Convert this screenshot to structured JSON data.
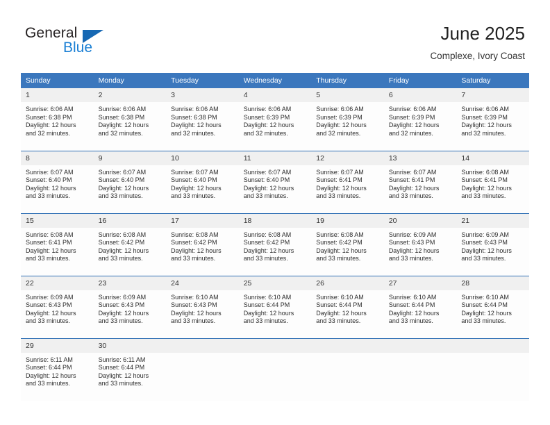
{
  "brand": {
    "name_part1": "General",
    "name_part2": "Blue",
    "triangle_icon": "triangle-logo-icon",
    "colors": {
      "dark": "#231f20",
      "blue": "#1a7fd4",
      "triangle": "#1668b3"
    }
  },
  "header": {
    "title": "June 2025",
    "subtitle": "Complexe, Ivory Coast"
  },
  "theme": {
    "header_blue": "#3b77bd",
    "row_divider_blue": "#2f6fb5",
    "daynum_band": "#f0f0f0",
    "cell_bg": "#fdfdfd",
    "text": "#2b2b2b"
  },
  "weekday_headers": [
    "Sunday",
    "Monday",
    "Tuesday",
    "Wednesday",
    "Thursday",
    "Friday",
    "Saturday"
  ],
  "weeks": [
    {
      "days": [
        {
          "num": "1",
          "sunrise": "Sunrise: 6:06 AM",
          "sunset": "Sunset: 6:38 PM",
          "daylight1": "Daylight: 12 hours",
          "daylight2": "and 32 minutes.",
          "blank": false
        },
        {
          "num": "2",
          "sunrise": "Sunrise: 6:06 AM",
          "sunset": "Sunset: 6:38 PM",
          "daylight1": "Daylight: 12 hours",
          "daylight2": "and 32 minutes.",
          "blank": false
        },
        {
          "num": "3",
          "sunrise": "Sunrise: 6:06 AM",
          "sunset": "Sunset: 6:38 PM",
          "daylight1": "Daylight: 12 hours",
          "daylight2": "and 32 minutes.",
          "blank": false
        },
        {
          "num": "4",
          "sunrise": "Sunrise: 6:06 AM",
          "sunset": "Sunset: 6:39 PM",
          "daylight1": "Daylight: 12 hours",
          "daylight2": "and 32 minutes.",
          "blank": false
        },
        {
          "num": "5",
          "sunrise": "Sunrise: 6:06 AM",
          "sunset": "Sunset: 6:39 PM",
          "daylight1": "Daylight: 12 hours",
          "daylight2": "and 32 minutes.",
          "blank": false
        },
        {
          "num": "6",
          "sunrise": "Sunrise: 6:06 AM",
          "sunset": "Sunset: 6:39 PM",
          "daylight1": "Daylight: 12 hours",
          "daylight2": "and 32 minutes.",
          "blank": false
        },
        {
          "num": "7",
          "sunrise": "Sunrise: 6:06 AM",
          "sunset": "Sunset: 6:39 PM",
          "daylight1": "Daylight: 12 hours",
          "daylight2": "and 32 minutes.",
          "blank": false
        }
      ]
    },
    {
      "days": [
        {
          "num": "8",
          "sunrise": "Sunrise: 6:07 AM",
          "sunset": "Sunset: 6:40 PM",
          "daylight1": "Daylight: 12 hours",
          "daylight2": "and 33 minutes.",
          "blank": false
        },
        {
          "num": "9",
          "sunrise": "Sunrise: 6:07 AM",
          "sunset": "Sunset: 6:40 PM",
          "daylight1": "Daylight: 12 hours",
          "daylight2": "and 33 minutes.",
          "blank": false
        },
        {
          "num": "10",
          "sunrise": "Sunrise: 6:07 AM",
          "sunset": "Sunset: 6:40 PM",
          "daylight1": "Daylight: 12 hours",
          "daylight2": "and 33 minutes.",
          "blank": false
        },
        {
          "num": "11",
          "sunrise": "Sunrise: 6:07 AM",
          "sunset": "Sunset: 6:40 PM",
          "daylight1": "Daylight: 12 hours",
          "daylight2": "and 33 minutes.",
          "blank": false
        },
        {
          "num": "12",
          "sunrise": "Sunrise: 6:07 AM",
          "sunset": "Sunset: 6:41 PM",
          "daylight1": "Daylight: 12 hours",
          "daylight2": "and 33 minutes.",
          "blank": false
        },
        {
          "num": "13",
          "sunrise": "Sunrise: 6:07 AM",
          "sunset": "Sunset: 6:41 PM",
          "daylight1": "Daylight: 12 hours",
          "daylight2": "and 33 minutes.",
          "blank": false
        },
        {
          "num": "14",
          "sunrise": "Sunrise: 6:08 AM",
          "sunset": "Sunset: 6:41 PM",
          "daylight1": "Daylight: 12 hours",
          "daylight2": "and 33 minutes.",
          "blank": false
        }
      ]
    },
    {
      "days": [
        {
          "num": "15",
          "sunrise": "Sunrise: 6:08 AM",
          "sunset": "Sunset: 6:41 PM",
          "daylight1": "Daylight: 12 hours",
          "daylight2": "and 33 minutes.",
          "blank": false
        },
        {
          "num": "16",
          "sunrise": "Sunrise: 6:08 AM",
          "sunset": "Sunset: 6:42 PM",
          "daylight1": "Daylight: 12 hours",
          "daylight2": "and 33 minutes.",
          "blank": false
        },
        {
          "num": "17",
          "sunrise": "Sunrise: 6:08 AM",
          "sunset": "Sunset: 6:42 PM",
          "daylight1": "Daylight: 12 hours",
          "daylight2": "and 33 minutes.",
          "blank": false
        },
        {
          "num": "18",
          "sunrise": "Sunrise: 6:08 AM",
          "sunset": "Sunset: 6:42 PM",
          "daylight1": "Daylight: 12 hours",
          "daylight2": "and 33 minutes.",
          "blank": false
        },
        {
          "num": "19",
          "sunrise": "Sunrise: 6:08 AM",
          "sunset": "Sunset: 6:42 PM",
          "daylight1": "Daylight: 12 hours",
          "daylight2": "and 33 minutes.",
          "blank": false
        },
        {
          "num": "20",
          "sunrise": "Sunrise: 6:09 AM",
          "sunset": "Sunset: 6:43 PM",
          "daylight1": "Daylight: 12 hours",
          "daylight2": "and 33 minutes.",
          "blank": false
        },
        {
          "num": "21",
          "sunrise": "Sunrise: 6:09 AM",
          "sunset": "Sunset: 6:43 PM",
          "daylight1": "Daylight: 12 hours",
          "daylight2": "and 33 minutes.",
          "blank": false
        }
      ]
    },
    {
      "days": [
        {
          "num": "22",
          "sunrise": "Sunrise: 6:09 AM",
          "sunset": "Sunset: 6:43 PM",
          "daylight1": "Daylight: 12 hours",
          "daylight2": "and 33 minutes.",
          "blank": false
        },
        {
          "num": "23",
          "sunrise": "Sunrise: 6:09 AM",
          "sunset": "Sunset: 6:43 PM",
          "daylight1": "Daylight: 12 hours",
          "daylight2": "and 33 minutes.",
          "blank": false
        },
        {
          "num": "24",
          "sunrise": "Sunrise: 6:10 AM",
          "sunset": "Sunset: 6:43 PM",
          "daylight1": "Daylight: 12 hours",
          "daylight2": "and 33 minutes.",
          "blank": false
        },
        {
          "num": "25",
          "sunrise": "Sunrise: 6:10 AM",
          "sunset": "Sunset: 6:44 PM",
          "daylight1": "Daylight: 12 hours",
          "daylight2": "and 33 minutes.",
          "blank": false
        },
        {
          "num": "26",
          "sunrise": "Sunrise: 6:10 AM",
          "sunset": "Sunset: 6:44 PM",
          "daylight1": "Daylight: 12 hours",
          "daylight2": "and 33 minutes.",
          "blank": false
        },
        {
          "num": "27",
          "sunrise": "Sunrise: 6:10 AM",
          "sunset": "Sunset: 6:44 PM",
          "daylight1": "Daylight: 12 hours",
          "daylight2": "and 33 minutes.",
          "blank": false
        },
        {
          "num": "28",
          "sunrise": "Sunrise: 6:10 AM",
          "sunset": "Sunset: 6:44 PM",
          "daylight1": "Daylight: 12 hours",
          "daylight2": "and 33 minutes.",
          "blank": false
        }
      ]
    },
    {
      "days": [
        {
          "num": "29",
          "sunrise": "Sunrise: 6:11 AM",
          "sunset": "Sunset: 6:44 PM",
          "daylight1": "Daylight: 12 hours",
          "daylight2": "and 33 minutes.",
          "blank": false
        },
        {
          "num": "30",
          "sunrise": "Sunrise: 6:11 AM",
          "sunset": "Sunset: 6:44 PM",
          "daylight1": "Daylight: 12 hours",
          "daylight2": "and 33 minutes.",
          "blank": false
        },
        {
          "num": "",
          "sunrise": "",
          "sunset": "",
          "daylight1": "",
          "daylight2": "",
          "blank": true
        },
        {
          "num": "",
          "sunrise": "",
          "sunset": "",
          "daylight1": "",
          "daylight2": "",
          "blank": true
        },
        {
          "num": "",
          "sunrise": "",
          "sunset": "",
          "daylight1": "",
          "daylight2": "",
          "blank": true
        },
        {
          "num": "",
          "sunrise": "",
          "sunset": "",
          "daylight1": "",
          "daylight2": "",
          "blank": true
        },
        {
          "num": "",
          "sunrise": "",
          "sunset": "",
          "daylight1": "",
          "daylight2": "",
          "blank": true
        }
      ]
    }
  ]
}
